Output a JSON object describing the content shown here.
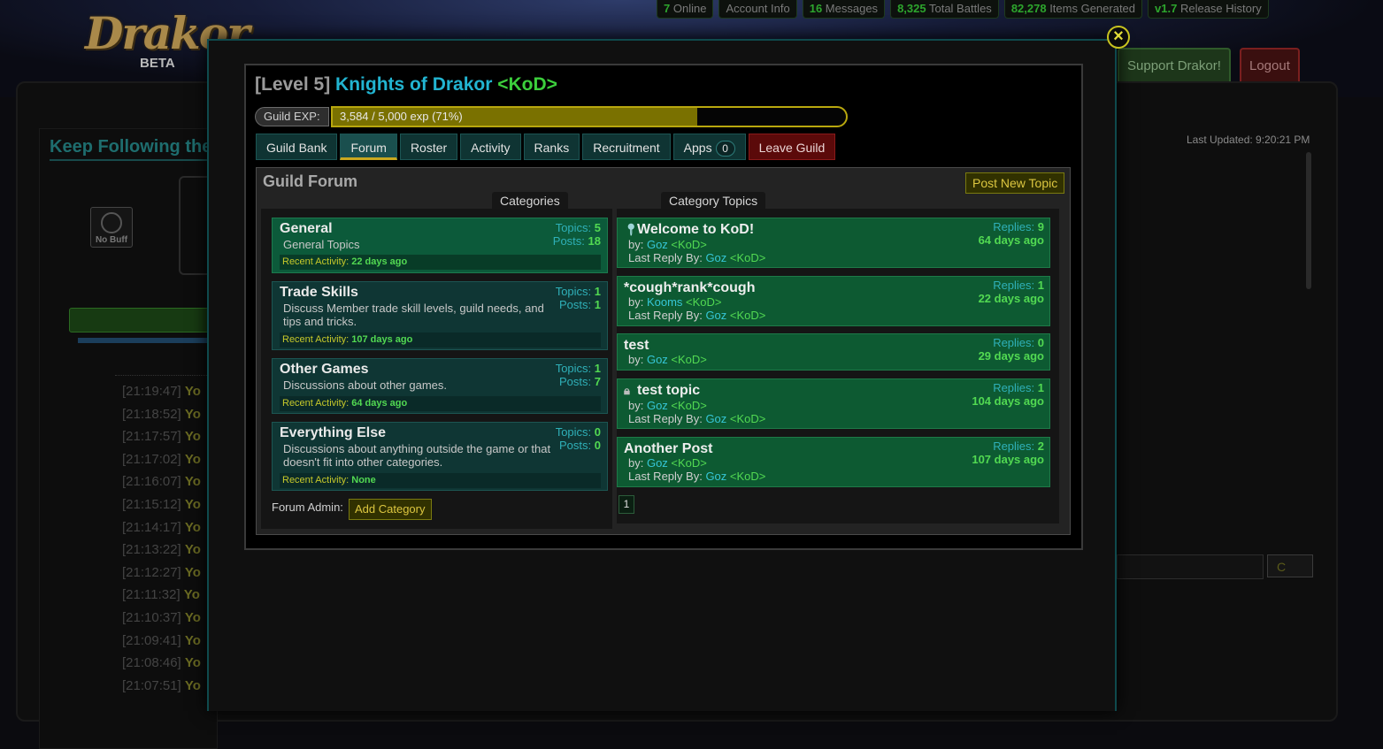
{
  "site": {
    "logo_text": "Drakor",
    "logo_sub": "BETA",
    "nav": [
      {
        "num": "7",
        "label": " Online"
      },
      {
        "num": "",
        "label": "Account Info"
      },
      {
        "num": "16",
        "label": " Messages"
      },
      {
        "num": "8,325",
        "label": " Total Battles"
      },
      {
        "num": "82,278",
        "label": " Items Generated"
      },
      {
        "num": "v1.7",
        "label": " Release History"
      }
    ],
    "support_label": "Support Drakor!",
    "logout_label": "Logout"
  },
  "background": {
    "left_title": "Keep Following the",
    "nobuff_label": "No Buff",
    "log": [
      {
        "time": "[21:19:47]",
        "who": "Yo"
      },
      {
        "time": "[21:18:52]",
        "who": "Yo"
      },
      {
        "time": "[21:17:57]",
        "who": "Yo"
      },
      {
        "time": "[21:17:02]",
        "who": "Yo"
      },
      {
        "time": "[21:16:07]",
        "who": "Yo"
      },
      {
        "time": "[21:15:12]",
        "who": "Yo"
      },
      {
        "time": "[21:14:17]",
        "who": "Yo"
      },
      {
        "time": "[21:13:22]",
        "who": "Yo"
      },
      {
        "time": "[21:12:27]",
        "who": "Yo"
      },
      {
        "time": "[21:11:32]",
        "who": "Yo"
      },
      {
        "time": "[21:10:37]",
        "who": "Yo"
      },
      {
        "time": "[21:09:41]",
        "who": "Yo"
      },
      {
        "time": "[21:08:46]",
        "who": "Yo"
      },
      {
        "time": "[21:07:51]",
        "who": "Yo"
      }
    ],
    "last_updated": "Last Updated: 9:20:21 PM",
    "chat_select": "C"
  },
  "guild": {
    "level_label": "[Level 5]",
    "name": "Knights of Drakor",
    "tag": "<KoD>",
    "exp_label": "Guild EXP:",
    "exp_text": "3,584 / 5,000 exp (71%)",
    "exp_percent": 71,
    "close_symbol": "×"
  },
  "tabs": [
    {
      "label": "Guild Bank",
      "active": false
    },
    {
      "label": "Forum",
      "active": true
    },
    {
      "label": "Roster",
      "active": false
    },
    {
      "label": "Activity",
      "active": false
    },
    {
      "label": "Ranks",
      "active": false
    },
    {
      "label": "Recruitment",
      "active": false
    },
    {
      "label": "Apps",
      "badge": "0",
      "active": false
    },
    {
      "label": "Leave Guild",
      "danger": true,
      "active": false
    }
  ],
  "forum": {
    "title": "Guild Forum",
    "post_new_label": "Post New Topic",
    "categories_header": "Categories",
    "topics_header": "Category Topics",
    "forum_admin_label": "Forum Admin:",
    "add_category_label": "Add Category",
    "page": "1",
    "categories": [
      {
        "name": "General",
        "desc": "General Topics",
        "topics_label": "Topics: ",
        "topics": "5",
        "posts_label": "Posts: ",
        "posts": "18",
        "activity_label": "Recent Activity: ",
        "activity": "22 days ago",
        "active": true
      },
      {
        "name": "Trade Skills",
        "desc": "Discuss Member trade skill levels, guild needs, and tips and tricks.",
        "topics_label": "Topics: ",
        "topics": "1",
        "posts_label": "Posts: ",
        "posts": "1",
        "activity_label": "Recent Activity: ",
        "activity": "107 days ago",
        "active": false
      },
      {
        "name": "Other Games",
        "desc": "Discussions about other games.",
        "topics_label": "Topics: ",
        "topics": "1",
        "posts_label": "Posts: ",
        "posts": "7",
        "activity_label": "Recent Activity: ",
        "activity": "64 days ago",
        "active": false
      },
      {
        "name": "Everything Else",
        "desc": "Discussions about anything outside the game or that doesn't fit into other categories.",
        "topics_label": "Topics: ",
        "topics": "0",
        "posts_label": "Posts: ",
        "posts": "0",
        "activity_label": "Recent Activity: ",
        "activity": "None",
        "active": false
      }
    ],
    "topics": [
      {
        "title": "Welcome to KoD!",
        "icon": "pin-icon",
        "by_label": "by: ",
        "by_user": "Goz",
        "by_tag": " <KoD>",
        "last_label": "Last Reply By: ",
        "last_user": "Goz",
        "last_tag": " <KoD>",
        "replies_label": "Replies: ",
        "replies": "9",
        "ago": "64 days ago"
      },
      {
        "title": "*cough*rank*cough",
        "icon": "",
        "by_label": "by: ",
        "by_user": "Kooms",
        "by_tag": " <KoD>",
        "last_label": "Last Reply By: ",
        "last_user": "Goz",
        "last_tag": " <KoD>",
        "replies_label": "Replies: ",
        "replies": "1",
        "ago": "22 days ago"
      },
      {
        "title": "test",
        "icon": "",
        "by_label": "by: ",
        "by_user": "Goz",
        "by_tag": " <KoD>",
        "last_label": "",
        "last_user": "",
        "last_tag": "",
        "replies_label": "Replies: ",
        "replies": "0",
        "ago": "29 days ago"
      },
      {
        "title": "test topic",
        "icon": "lock-icon",
        "by_label": "by: ",
        "by_user": "Goz",
        "by_tag": " <KoD>",
        "last_label": "Last Reply By: ",
        "last_user": "Goz",
        "last_tag": " <KoD>",
        "replies_label": "Replies: ",
        "replies": "1",
        "ago": "104 days ago"
      },
      {
        "title": "Another Post",
        "icon": "",
        "by_label": "by: ",
        "by_user": "Goz",
        "by_tag": " <KoD>",
        "last_label": "Last Reply By: ",
        "last_user": "Goz",
        "last_tag": " <KoD>",
        "replies_label": "Replies: ",
        "replies": "2",
        "ago": "107 days ago"
      }
    ]
  }
}
